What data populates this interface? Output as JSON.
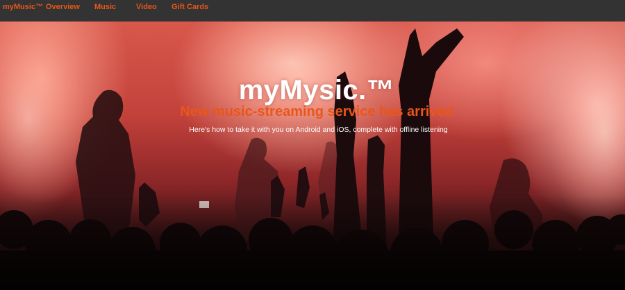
{
  "navbar": {
    "brand": "myMusic™",
    "links": [
      {
        "label": "Overview"
      },
      {
        "label": "Music"
      },
      {
        "label": "Video"
      },
      {
        "label": "Gift Cards"
      }
    ]
  },
  "hero": {
    "title": "myMysic.™",
    "subtitle": "New music-streaming service has arrived",
    "description": "Here's how to take it with you on Android and iOS, complete with offline listening",
    "image": "concert-crowd-photo"
  },
  "colors": {
    "navbar_bg": "#333333",
    "accent": "#e8561a",
    "title_text": "#ffffff"
  }
}
